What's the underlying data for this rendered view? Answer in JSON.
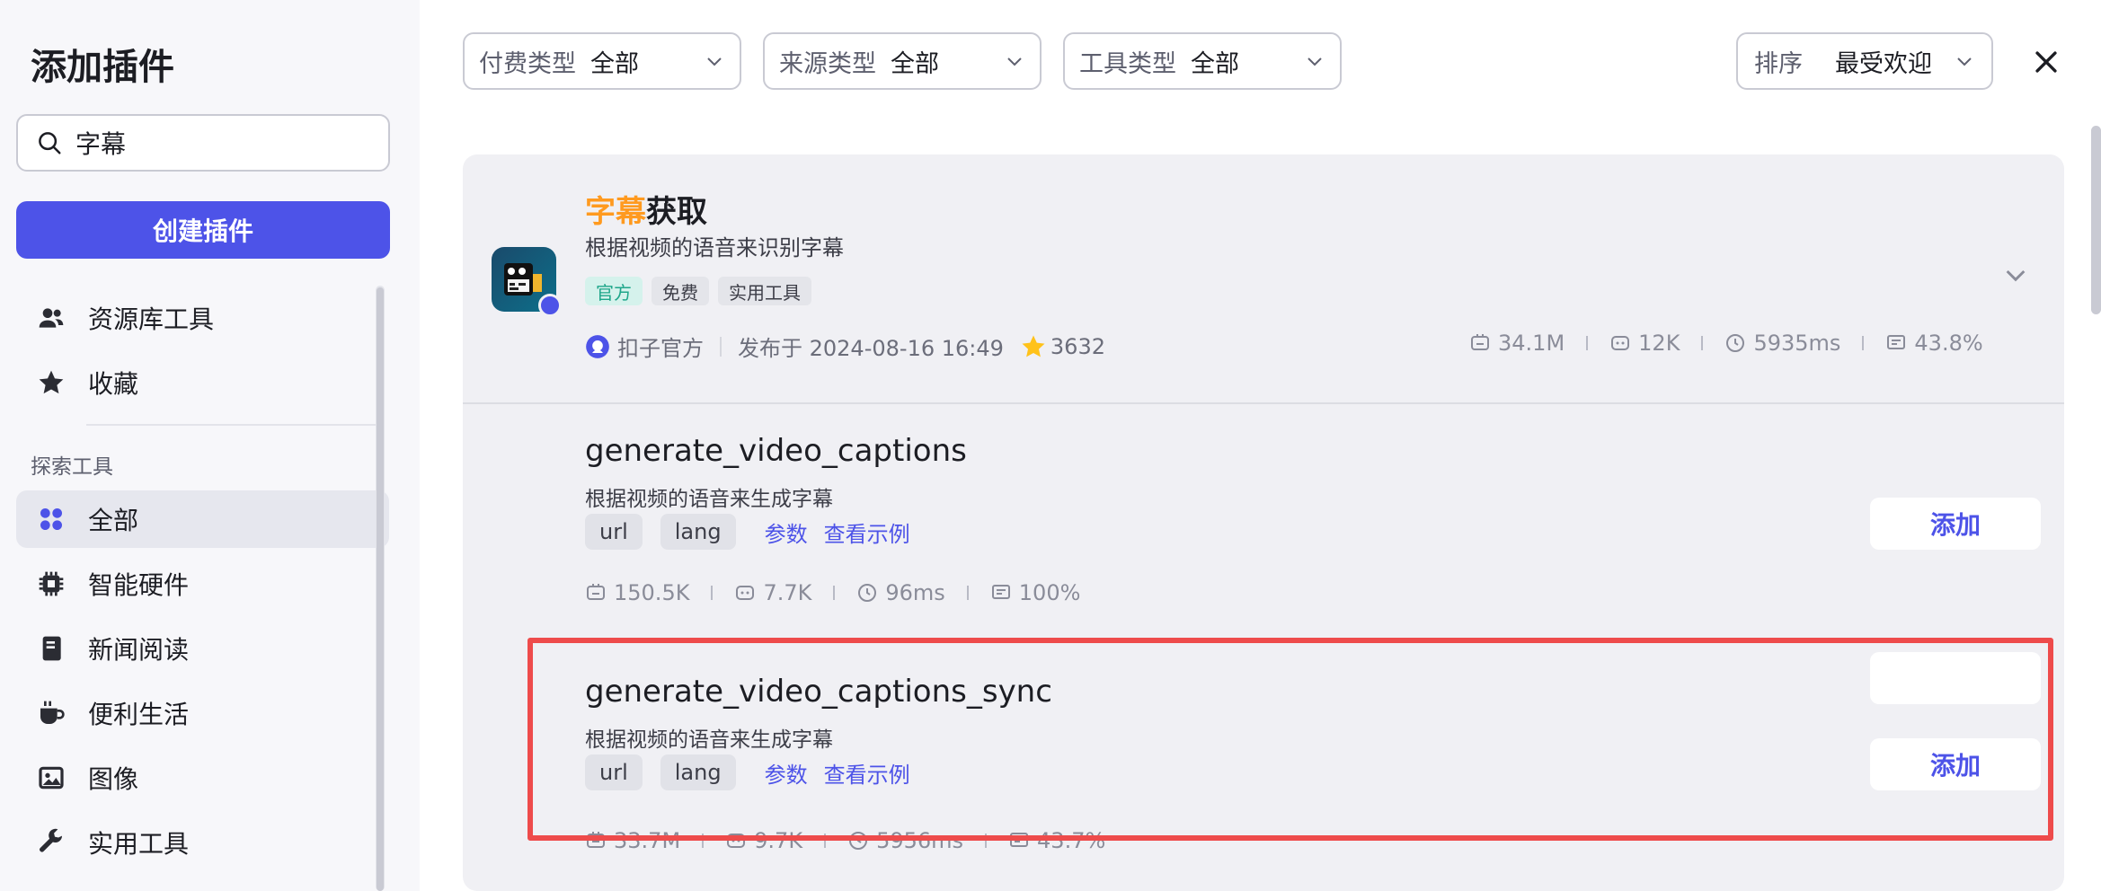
{
  "sidebar": {
    "title": "添加插件",
    "search": {
      "value": "字幕"
    },
    "create_button": "创建插件",
    "items_top": [
      {
        "label": "资源库工具",
        "icon": "users-icon"
      },
      {
        "label": "收藏",
        "icon": "star-icon"
      }
    ],
    "section_label": "探索工具",
    "items_explore": [
      {
        "label": "全部",
        "icon": "grid-icon",
        "active": true
      },
      {
        "label": "智能硬件",
        "icon": "chip-icon"
      },
      {
        "label": "新闻阅读",
        "icon": "book-icon"
      },
      {
        "label": "便利生活",
        "icon": "cup-icon"
      },
      {
        "label": "图像",
        "icon": "image-icon"
      },
      {
        "label": "实用工具",
        "icon": "wrench-icon"
      }
    ]
  },
  "filters": [
    {
      "label": "付费类型",
      "value": "全部"
    },
    {
      "label": "来源类型",
      "value": "全部"
    },
    {
      "label": "工具类型",
      "value": "全部"
    }
  ],
  "sort": {
    "label": "排序",
    "value": "最受欢迎"
  },
  "plugin": {
    "title_highlight": "字幕",
    "title_rest": "获取",
    "description": "根据视频的语音来识别字幕",
    "tags": [
      "官方",
      "免费",
      "实用工具"
    ],
    "publisher": "扣子官方",
    "published": "发布于 2024-08-16 16:49",
    "stars": "3632",
    "stats": [
      "34.1M",
      "12K",
      "5935ms",
      "43.8%"
    ]
  },
  "tools": [
    {
      "name": "generate_video_captions",
      "description": "根据视频的语音来生成字幕",
      "params": [
        "url",
        "lang"
      ],
      "params_link": "参数",
      "example_link": "查看示例",
      "stats": [
        "150.5K",
        "7.7K",
        "96ms",
        "100%"
      ],
      "add_label": "添加"
    },
    {
      "name": "generate_video_captions_sync",
      "description": "根据视频的语音来生成字幕",
      "params": [
        "url",
        "lang"
      ],
      "params_link": "参数",
      "example_link": "查看示例",
      "stats": [
        "33.7M",
        "9.7K",
        "5956ms",
        "43.7%"
      ],
      "add_label": "添加"
    }
  ],
  "colors": {
    "accent": "#4d53e8",
    "highlight": "#ff9a1f",
    "annotation": "#ee4b4b"
  }
}
